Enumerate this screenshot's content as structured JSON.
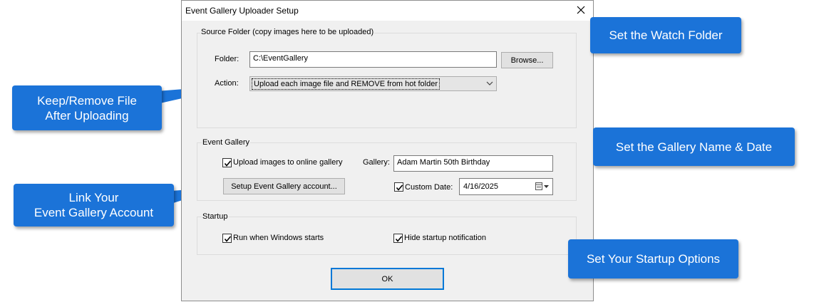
{
  "dialog": {
    "title": "Event Gallery Uploader Setup",
    "close_glyph": "✕"
  },
  "source": {
    "group_label": "Source Folder (copy images here to be uploaded)",
    "folder_label": "Folder:",
    "folder_value": "C:\\EventGallery",
    "browse_label": "Browse...",
    "action_label": "Action:",
    "action_value": "Upload each image file and REMOVE from hot folder"
  },
  "gallery": {
    "group_label": "Event Gallery",
    "upload_label": "Upload images to online gallery",
    "upload_checked": true,
    "gallery_label": "Gallery:",
    "gallery_value": "Adam Martin 50th Birthday",
    "setup_button_label": "Setup Event Gallery account...",
    "custom_date_label": "Custom Date:",
    "custom_date_checked": true,
    "date_value": "4/16/2025"
  },
  "startup": {
    "group_label": "Startup",
    "run_label": "Run when Windows starts",
    "run_checked": true,
    "hide_label": "Hide startup notification",
    "hide_checked": true
  },
  "ok_label": "OK",
  "callouts": {
    "watch_folder": "Set the Watch Folder",
    "keep_remove": "Keep/Remove File\nAfter Uploading",
    "gallery_name": "Set the Gallery Name & Date",
    "link_account": "Link Your\nEvent Gallery Account",
    "startup": "Set Your Startup Options"
  },
  "colors": {
    "callout": "#1b73d8",
    "dialog_bg": "#f0f0f0"
  }
}
